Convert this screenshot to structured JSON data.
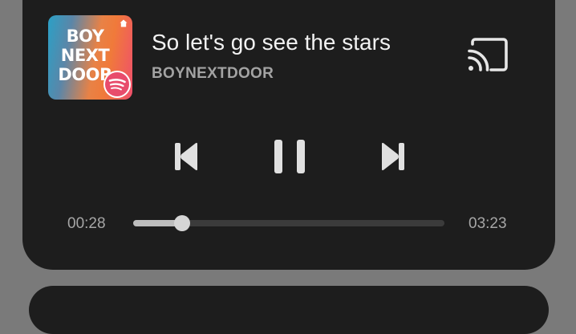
{
  "player": {
    "album_art": {
      "logo_text": [
        "BOY",
        "NEXT",
        "DOOR"
      ],
      "badge_icon": "spotify-icon",
      "corner_icon": "home-icon"
    },
    "track_title": "So let's go see the stars",
    "artist": "BOYNEXTDOOR",
    "controls": {
      "previous_icon": "skip-previous-icon",
      "pause_icon": "pause-icon",
      "next_icon": "skip-next-icon",
      "cast_icon": "cast-icon"
    },
    "progress": {
      "elapsed": "00:28",
      "total": "03:23",
      "fraction": 0.158
    }
  },
  "colors": {
    "card_background": "#1d1d1d",
    "page_background": "#7a7a7a",
    "title_text": "#f2f2f2",
    "secondary_text": "#a3a3a3",
    "spotify_green": "#1db954"
  }
}
